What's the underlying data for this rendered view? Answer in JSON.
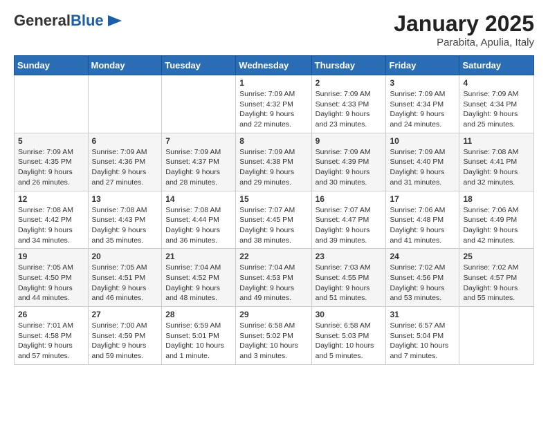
{
  "header": {
    "logo_general": "General",
    "logo_blue": "Blue",
    "month_title": "January 2025",
    "location": "Parabita, Apulia, Italy"
  },
  "days_of_week": [
    "Sunday",
    "Monday",
    "Tuesday",
    "Wednesday",
    "Thursday",
    "Friday",
    "Saturday"
  ],
  "weeks": [
    [
      {
        "day": "",
        "info": ""
      },
      {
        "day": "",
        "info": ""
      },
      {
        "day": "",
        "info": ""
      },
      {
        "day": "1",
        "info": "Sunrise: 7:09 AM\nSunset: 4:32 PM\nDaylight: 9 hours\nand 22 minutes."
      },
      {
        "day": "2",
        "info": "Sunrise: 7:09 AM\nSunset: 4:33 PM\nDaylight: 9 hours\nand 23 minutes."
      },
      {
        "day": "3",
        "info": "Sunrise: 7:09 AM\nSunset: 4:34 PM\nDaylight: 9 hours\nand 24 minutes."
      },
      {
        "day": "4",
        "info": "Sunrise: 7:09 AM\nSunset: 4:34 PM\nDaylight: 9 hours\nand 25 minutes."
      }
    ],
    [
      {
        "day": "5",
        "info": "Sunrise: 7:09 AM\nSunset: 4:35 PM\nDaylight: 9 hours\nand 26 minutes."
      },
      {
        "day": "6",
        "info": "Sunrise: 7:09 AM\nSunset: 4:36 PM\nDaylight: 9 hours\nand 27 minutes."
      },
      {
        "day": "7",
        "info": "Sunrise: 7:09 AM\nSunset: 4:37 PM\nDaylight: 9 hours\nand 28 minutes."
      },
      {
        "day": "8",
        "info": "Sunrise: 7:09 AM\nSunset: 4:38 PM\nDaylight: 9 hours\nand 29 minutes."
      },
      {
        "day": "9",
        "info": "Sunrise: 7:09 AM\nSunset: 4:39 PM\nDaylight: 9 hours\nand 30 minutes."
      },
      {
        "day": "10",
        "info": "Sunrise: 7:09 AM\nSunset: 4:40 PM\nDaylight: 9 hours\nand 31 minutes."
      },
      {
        "day": "11",
        "info": "Sunrise: 7:08 AM\nSunset: 4:41 PM\nDaylight: 9 hours\nand 32 minutes."
      }
    ],
    [
      {
        "day": "12",
        "info": "Sunrise: 7:08 AM\nSunset: 4:42 PM\nDaylight: 9 hours\nand 34 minutes."
      },
      {
        "day": "13",
        "info": "Sunrise: 7:08 AM\nSunset: 4:43 PM\nDaylight: 9 hours\nand 35 minutes."
      },
      {
        "day": "14",
        "info": "Sunrise: 7:08 AM\nSunset: 4:44 PM\nDaylight: 9 hours\nand 36 minutes."
      },
      {
        "day": "15",
        "info": "Sunrise: 7:07 AM\nSunset: 4:45 PM\nDaylight: 9 hours\nand 38 minutes."
      },
      {
        "day": "16",
        "info": "Sunrise: 7:07 AM\nSunset: 4:47 PM\nDaylight: 9 hours\nand 39 minutes."
      },
      {
        "day": "17",
        "info": "Sunrise: 7:06 AM\nSunset: 4:48 PM\nDaylight: 9 hours\nand 41 minutes."
      },
      {
        "day": "18",
        "info": "Sunrise: 7:06 AM\nSunset: 4:49 PM\nDaylight: 9 hours\nand 42 minutes."
      }
    ],
    [
      {
        "day": "19",
        "info": "Sunrise: 7:05 AM\nSunset: 4:50 PM\nDaylight: 9 hours\nand 44 minutes."
      },
      {
        "day": "20",
        "info": "Sunrise: 7:05 AM\nSunset: 4:51 PM\nDaylight: 9 hours\nand 46 minutes."
      },
      {
        "day": "21",
        "info": "Sunrise: 7:04 AM\nSunset: 4:52 PM\nDaylight: 9 hours\nand 48 minutes."
      },
      {
        "day": "22",
        "info": "Sunrise: 7:04 AM\nSunset: 4:53 PM\nDaylight: 9 hours\nand 49 minutes."
      },
      {
        "day": "23",
        "info": "Sunrise: 7:03 AM\nSunset: 4:55 PM\nDaylight: 9 hours\nand 51 minutes."
      },
      {
        "day": "24",
        "info": "Sunrise: 7:02 AM\nSunset: 4:56 PM\nDaylight: 9 hours\nand 53 minutes."
      },
      {
        "day": "25",
        "info": "Sunrise: 7:02 AM\nSunset: 4:57 PM\nDaylight: 9 hours\nand 55 minutes."
      }
    ],
    [
      {
        "day": "26",
        "info": "Sunrise: 7:01 AM\nSunset: 4:58 PM\nDaylight: 9 hours\nand 57 minutes."
      },
      {
        "day": "27",
        "info": "Sunrise: 7:00 AM\nSunset: 4:59 PM\nDaylight: 9 hours\nand 59 minutes."
      },
      {
        "day": "28",
        "info": "Sunrise: 6:59 AM\nSunset: 5:01 PM\nDaylight: 10 hours\nand 1 minute."
      },
      {
        "day": "29",
        "info": "Sunrise: 6:58 AM\nSunset: 5:02 PM\nDaylight: 10 hours\nand 3 minutes."
      },
      {
        "day": "30",
        "info": "Sunrise: 6:58 AM\nSunset: 5:03 PM\nDaylight: 10 hours\nand 5 minutes."
      },
      {
        "day": "31",
        "info": "Sunrise: 6:57 AM\nSunset: 5:04 PM\nDaylight: 10 hours\nand 7 minutes."
      },
      {
        "day": "",
        "info": ""
      }
    ]
  ]
}
